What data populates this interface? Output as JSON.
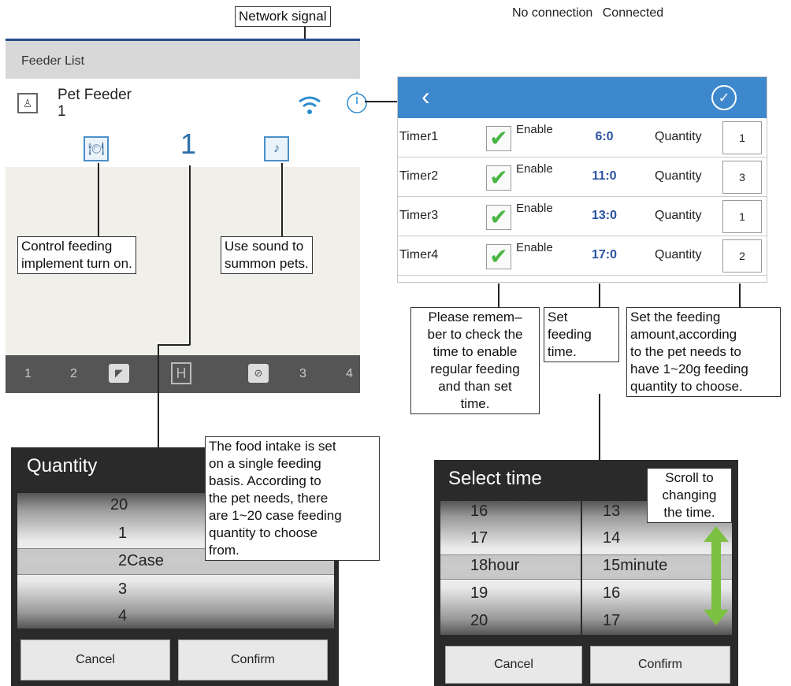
{
  "legend": {
    "no_connection": "No connection",
    "connected": "Connected"
  },
  "callouts": {
    "network_signal": "Network signal",
    "control_feeding": [
      "Control feeding",
      "implement turn on."
    ],
    "use_sound": [
      "Use sound to",
      "summon pets."
    ],
    "remember_check": [
      "Please remem–",
      "ber to check the",
      "time to enable",
      "regular feeding",
      "and than set",
      "time."
    ],
    "set_feeding_time": [
      "Set",
      "feeding",
      "time."
    ],
    "set_amount": [
      "Set the feeding",
      "amount,according",
      "to the pet needs to",
      "have 1~20g feeding",
      "quantity to choose."
    ],
    "food_intake": [
      "The food intake is set",
      "on a single feeding",
      "basis. According to",
      "the pet needs, there",
      "are 1~20 case feeding",
      "quantity to choose",
      "from."
    ],
    "scroll_time": [
      "Scroll to",
      "changing",
      "the time."
    ]
  },
  "feeder": {
    "header": "Feeder List",
    "device_name": "Pet Feeder",
    "device_sub": "1",
    "count": "1",
    "nav": [
      "1",
      "2",
      "3",
      "4"
    ]
  },
  "timers": {
    "back": "‹",
    "confirm_icon": "✓",
    "enable_label": "Enable",
    "quantity_label": "Quantity",
    "rows": [
      {
        "name": "Timer1",
        "time": "6:0",
        "qty": "1"
      },
      {
        "name": "Timer2",
        "time": "11:0",
        "qty": "3"
      },
      {
        "name": "Timer3",
        "time": "13:0",
        "qty": "1"
      },
      {
        "name": "Timer4",
        "time": "17:0",
        "qty": "2"
      }
    ]
  },
  "quantity_picker": {
    "title": "Quantity",
    "items": [
      "20",
      "1",
      "2",
      "3",
      "4"
    ],
    "unit": "Case",
    "cancel": "Cancel",
    "confirm": "Confirm"
  },
  "time_picker": {
    "title": "Select time",
    "hours": [
      "16",
      "17",
      "18",
      "19",
      "20"
    ],
    "minutes": [
      "13",
      "14",
      "15",
      "16",
      "17"
    ],
    "hour_unit": "hour",
    "minute_unit": "minute",
    "cancel": "Cancel",
    "confirm": "Confirm"
  },
  "colors": {
    "accent": "#3d87cd",
    "check": "#49b544",
    "time": "#2952a3",
    "arrow": "#7cc142"
  }
}
